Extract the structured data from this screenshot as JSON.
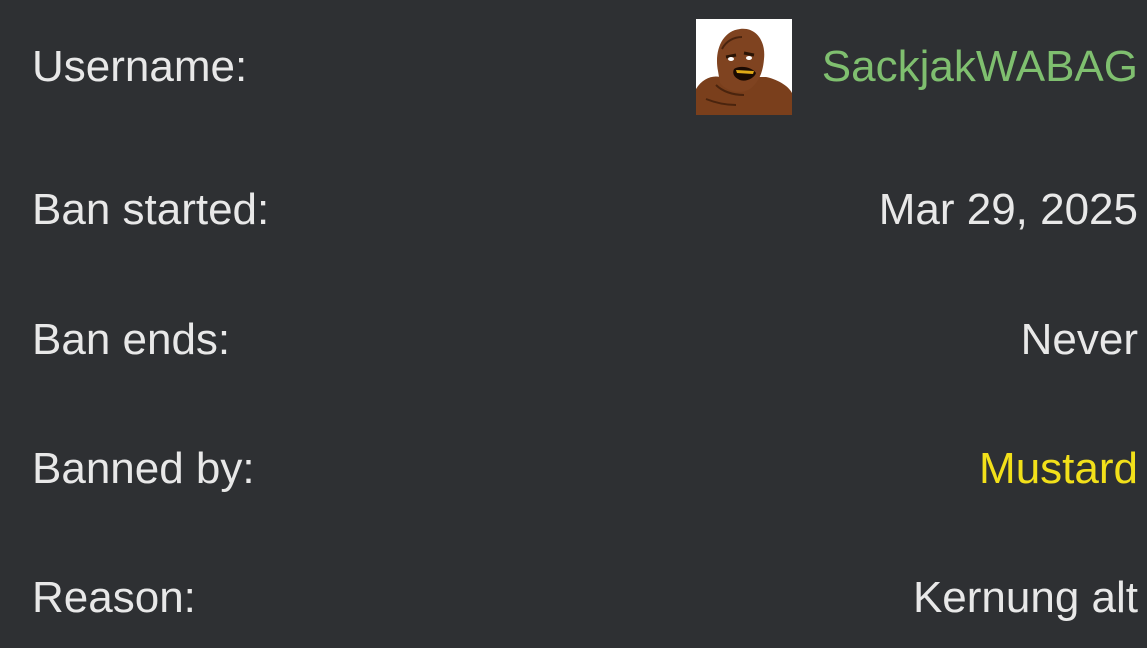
{
  "ban": {
    "username_label": "Username:",
    "username": "SackjakWABAG",
    "username_color": "#7fbf6f",
    "avatar_icon": "avatar-face-icon",
    "start_label": "Ban started:",
    "start_value": "Mar 29, 2025",
    "end_label": "Ban ends:",
    "end_value": "Never",
    "banned_by_label": "Banned by:",
    "banned_by_value": "Mustard",
    "banned_by_color": "#f2e01a",
    "reason_label": "Reason:",
    "reason_value": "Kernung alt"
  },
  "colors": {
    "background": "#2e3033",
    "text": "#e8e8e8"
  }
}
